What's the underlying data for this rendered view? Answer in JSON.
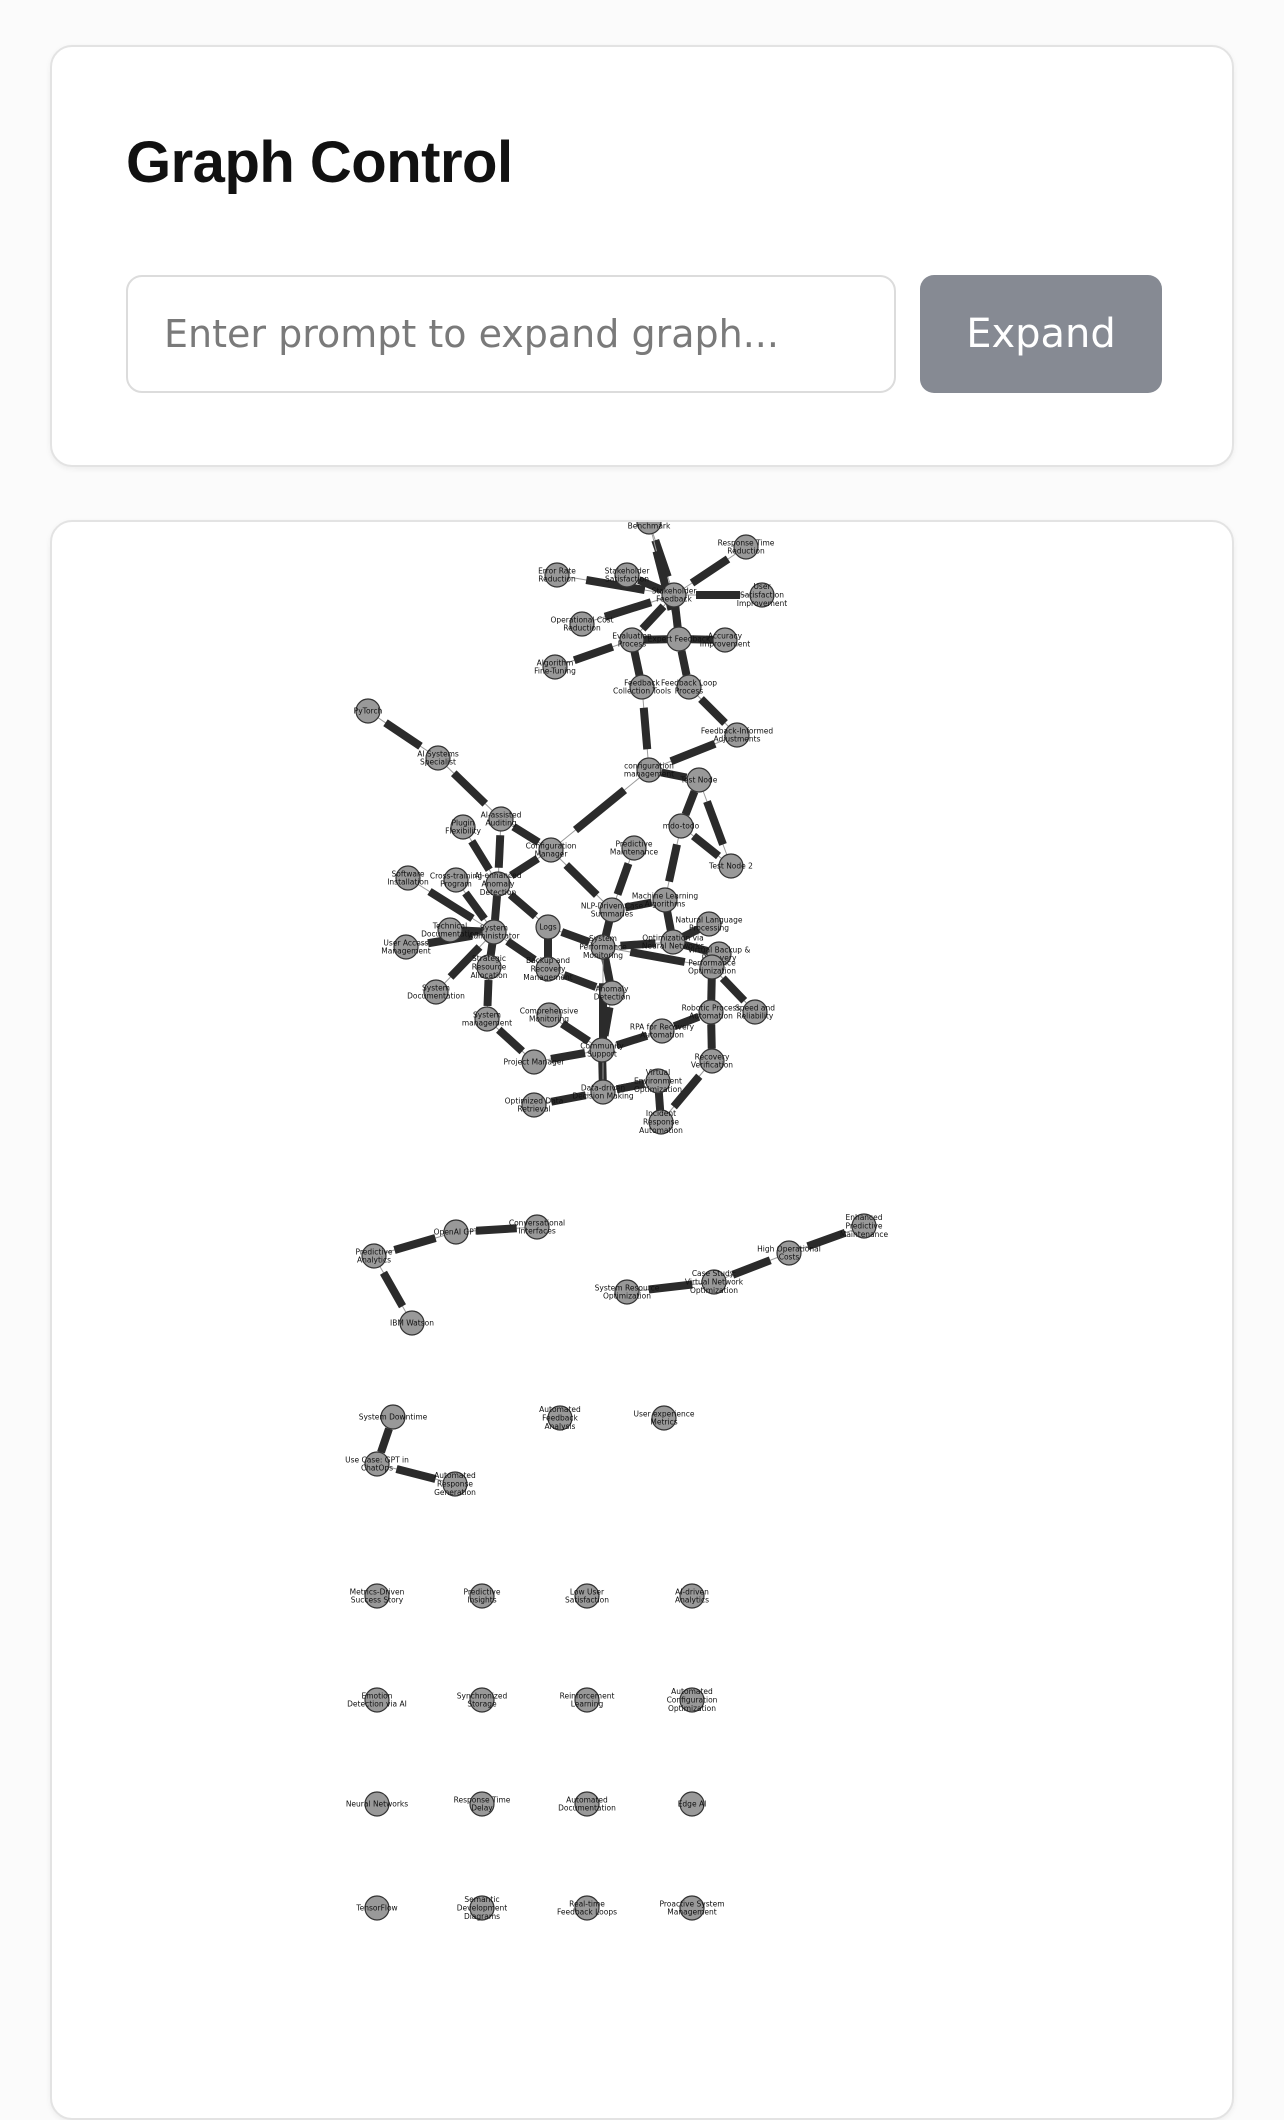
{
  "control": {
    "title": "Graph Control",
    "input_placeholder": "Enter prompt to expand graph...",
    "input_value": "",
    "expand_label": "Expand"
  },
  "graph": {
    "colors": {
      "node_fill": "#999999",
      "node_stroke": "#333333",
      "edge": "#2b2b2b"
    },
    "nodes": [
      {
        "id": "n_top",
        "label": "Performance Case Benchmark"
      },
      {
        "id": "n_resp_red",
        "label": "Response Time Reduction"
      },
      {
        "id": "n_err_red",
        "label": "Error Rate Reduction"
      },
      {
        "id": "n_stake_sat",
        "label": "Stakeholder Satisfaction"
      },
      {
        "id": "n_stake_fb",
        "label": "Stakeholder Feedback"
      },
      {
        "id": "n_user_sat",
        "label": "User Satisfaction Improvement"
      },
      {
        "id": "n_opcost",
        "label": "Operational Cost Reduction"
      },
      {
        "id": "n_eval",
        "label": "Evaluation Process"
      },
      {
        "id": "n_expert",
        "label": "Expert Feedback"
      },
      {
        "id": "n_accuracy",
        "label": "Accuracy Improvement"
      },
      {
        "id": "n_algo",
        "label": "Algorithm Fine-Tuning"
      },
      {
        "id": "n_fbcoll",
        "label": "Feedback Collection Tools"
      },
      {
        "id": "n_fbloop",
        "label": "Feedback Loop Process"
      },
      {
        "id": "n_pytorch",
        "label": "PyTorch"
      },
      {
        "id": "n_fbadj",
        "label": "Feedback-Informed Adjustments"
      },
      {
        "id": "n_aispec",
        "label": "AI Systems Specialist"
      },
      {
        "id": "n_config",
        "label": "configuration management"
      },
      {
        "id": "n_test",
        "label": "Test Node"
      },
      {
        "id": "n_aiassist",
        "label": "AI-assisted Auditing"
      },
      {
        "id": "n_plugin",
        "label": "Plugin Flexibility"
      },
      {
        "id": "n_mdo",
        "label": "mdo-todo"
      },
      {
        "id": "n_configmgr",
        "label": "Configuration Manager"
      },
      {
        "id": "n_predmaint",
        "label": "Predictive Maintenance"
      },
      {
        "id": "n_test2",
        "label": "Test Node 2"
      },
      {
        "id": "n_swinst",
        "label": "Software Installation"
      },
      {
        "id": "n_cross",
        "label": "Cross-training Program"
      },
      {
        "id": "n_aianom",
        "label": "AI-enhanced Anomaly Detection"
      },
      {
        "id": "n_ml",
        "label": "Machine Learning Algorithms"
      },
      {
        "id": "n_nlp",
        "label": "NLP-Driven Case Summaries"
      },
      {
        "id": "n_natlang",
        "label": "Natural Language Processing"
      },
      {
        "id": "n_techdoc",
        "label": "Technical Documentation"
      },
      {
        "id": "n_sysadmin",
        "label": "System Administrator"
      },
      {
        "id": "n_logs",
        "label": "Logs"
      },
      {
        "id": "n_useracc",
        "label": "User Access Management"
      },
      {
        "id": "n_sysperf",
        "label": "System Performance Monitoring"
      },
      {
        "id": "n_optnn",
        "label": "Optimization via Neural Networks"
      },
      {
        "id": "n_backup",
        "label": "Virtual Backup & Recovery"
      },
      {
        "id": "n_strat",
        "label": "Strategic Resource Allocation"
      },
      {
        "id": "n_bkrec",
        "label": "Backup and Recovery Management"
      },
      {
        "id": "n_perfopt",
        "label": "Performance Optimization"
      },
      {
        "id": "n_sysdoc",
        "label": "System Documentation"
      },
      {
        "id": "n_anomaly",
        "label": "Anomaly Detection"
      },
      {
        "id": "n_robproc",
        "label": "Robotic Process Automation"
      },
      {
        "id": "n_speed",
        "label": "Speed and Reliability"
      },
      {
        "id": "n_sysmgmt",
        "label": "System management"
      },
      {
        "id": "n_compmon",
        "label": "Comprehensive Monitoring"
      },
      {
        "id": "n_rpa",
        "label": "RPA for Recovery Automation"
      },
      {
        "id": "n_recver",
        "label": "Recovery Verification"
      },
      {
        "id": "n_projmgr",
        "label": "Project Manager"
      },
      {
        "id": "n_commsupport",
        "label": "Community Support"
      },
      {
        "id": "n_virtenv",
        "label": "Virtual Environment Optimization"
      },
      {
        "id": "n_datadriven",
        "label": "Data-driven Decision Making"
      },
      {
        "id": "n_optdata",
        "label": "Optimized Data Retrieval"
      },
      {
        "id": "n_incident",
        "label": "Incident Response Automation"
      },
      {
        "id": "n_convo",
        "label": "Conversational Interfaces"
      },
      {
        "id": "n_openai",
        "label": "OpenAI GPT"
      },
      {
        "id": "n_predanal",
        "label": "Predictive Analytics"
      },
      {
        "id": "n_ibm",
        "label": "IBM Watson"
      },
      {
        "id": "n_enhpred",
        "label": "Enhanced Predictive Maintenance"
      },
      {
        "id": "n_highcost",
        "label": "High Operational Costs"
      },
      {
        "id": "n_casestudy",
        "label": "Case Study: Virtual Network Optimization"
      },
      {
        "id": "n_sysres",
        "label": "System Resource Optimization"
      },
      {
        "id": "n_downtime",
        "label": "System Downtime"
      },
      {
        "id": "n_autofb",
        "label": "Automated Feedback Analysis"
      },
      {
        "id": "n_uxmetrics",
        "label": "User experience Metrics"
      },
      {
        "id": "n_chatgpt",
        "label": "Use Case: GPT in ChatOps"
      },
      {
        "id": "n_autoresp",
        "label": "Automated Response Generation"
      },
      {
        "id": "n_metrics",
        "label": "Metrics-Driven Success Story"
      },
      {
        "id": "n_predins",
        "label": "Predictive Insights"
      },
      {
        "id": "n_lowuser",
        "label": "Low User Satisfaction"
      },
      {
        "id": "n_aidriven",
        "label": "AI-driven Analytics"
      },
      {
        "id": "n_emotion",
        "label": "Emotion Detection via AI"
      },
      {
        "id": "n_synchro",
        "label": "Synchronized Storage"
      },
      {
        "id": "n_reinf",
        "label": "Reinforcement Learning"
      },
      {
        "id": "n_autoconf",
        "label": "Automated Configuration Optimization"
      },
      {
        "id": "n_neural",
        "label": "Neural Networks"
      },
      {
        "id": "n_resptime",
        "label": "Response Time Delay"
      },
      {
        "id": "n_autodoc",
        "label": "Automated Documentation"
      },
      {
        "id": "n_edge",
        "label": "Edge AI"
      },
      {
        "id": "n_tf",
        "label": "TensorFlow"
      },
      {
        "id": "n_sdd",
        "label": "Semantic Development Diagrams"
      },
      {
        "id": "n_realtime",
        "label": "Real-time Feedback Loops"
      },
      {
        "id": "n_proactive",
        "label": "Proactive System Management"
      }
    ],
    "edges": [
      [
        "n_top",
        "n_stake_fb"
      ],
      [
        "n_top",
        "n_expert"
      ],
      [
        "n_resp_red",
        "n_stake_fb"
      ],
      [
        "n_err_red",
        "n_stake_fb"
      ],
      [
        "n_stake_sat",
        "n_stake_fb"
      ],
      [
        "n_user_sat",
        "n_stake_fb"
      ],
      [
        "n_opcost",
        "n_stake_fb"
      ],
      [
        "n_eval",
        "n_stake_fb"
      ],
      [
        "n_expert",
        "n_stake_fb"
      ],
      [
        "n_accuracy",
        "n_expert"
      ],
      [
        "n_algo",
        "n_eval"
      ],
      [
        "n_eval",
        "n_expert"
      ],
      [
        "n_fbcoll",
        "n_eval"
      ],
      [
        "n_fbloop",
        "n_expert"
      ],
      [
        "n_fbloop",
        "n_fbadj"
      ],
      [
        "n_fbcoll",
        "n_config"
      ],
      [
        "n_fbadj",
        "n_config"
      ],
      [
        "n_pytorch",
        "n_aispec"
      ],
      [
        "n_aispec",
        "n_aiassist"
      ],
      [
        "n_config",
        "n_test"
      ],
      [
        "n_config",
        "n_configmgr"
      ],
      [
        "n_test",
        "n_mdo"
      ],
      [
        "n_test",
        "n_test2"
      ],
      [
        "n_mdo",
        "n_test2"
      ],
      [
        "n_mdo",
        "n_ml"
      ],
      [
        "n_aiassist",
        "n_configmgr"
      ],
      [
        "n_aiassist",
        "n_aianom"
      ],
      [
        "n_plugin",
        "n_aianom"
      ],
      [
        "n_configmgr",
        "n_aianom"
      ],
      [
        "n_configmgr",
        "n_nlp"
      ],
      [
        "n_predmaint",
        "n_nlp"
      ],
      [
        "n_swinst",
        "n_sysadmin"
      ],
      [
        "n_cross",
        "n_sysadmin"
      ],
      [
        "n_aianom",
        "n_sysadmin"
      ],
      [
        "n_aianom",
        "n_logs"
      ],
      [
        "n_techdoc",
        "n_sysadmin"
      ],
      [
        "n_useracc",
        "n_sysadmin"
      ],
      [
        "n_sysadmin",
        "n_strat"
      ],
      [
        "n_sysadmin",
        "n_bkrec"
      ],
      [
        "n_sysadmin",
        "n_sysdoc"
      ],
      [
        "n_logs",
        "n_sysperf"
      ],
      [
        "n_logs",
        "n_bkrec"
      ],
      [
        "n_ml",
        "n_optnn"
      ],
      [
        "n_ml",
        "n_nlp"
      ],
      [
        "n_natlang",
        "n_optnn"
      ],
      [
        "n_nlp",
        "n_sysperf"
      ],
      [
        "n_sysperf",
        "n_optnn"
      ],
      [
        "n_optnn",
        "n_backup"
      ],
      [
        "n_backup",
        "n_perfopt"
      ],
      [
        "n_sysperf",
        "n_perfopt"
      ],
      [
        "n_perfopt",
        "n_robproc"
      ],
      [
        "n_perfopt",
        "n_speed"
      ],
      [
        "n_bkrec",
        "n_anomaly"
      ],
      [
        "n_anomaly",
        "n_sysperf"
      ],
      [
        "n_strat",
        "n_sysmgmt"
      ],
      [
        "n_sysmgmt",
        "n_projmgr"
      ],
      [
        "n_compmon",
        "n_commsupport"
      ],
      [
        "n_robproc",
        "n_rpa"
      ],
      [
        "n_rpa",
        "n_commsupport"
      ],
      [
        "n_robproc",
        "n_recver"
      ],
      [
        "n_projmgr",
        "n_commsupport"
      ],
      [
        "n_commsupport",
        "n_datadriven"
      ],
      [
        "n_virtenv",
        "n_datadriven"
      ],
      [
        "n_recver",
        "n_incident"
      ],
      [
        "n_optdata",
        "n_datadriven"
      ],
      [
        "n_datadriven",
        "n_virtenv"
      ],
      [
        "n_virtenv",
        "n_incident"
      ],
      [
        "n_anomaly",
        "n_commsupport"
      ],
      [
        "n_sysperf",
        "n_datadriven"
      ],
      [
        "n_convo",
        "n_openai"
      ],
      [
        "n_openai",
        "n_predanal"
      ],
      [
        "n_predanal",
        "n_ibm"
      ],
      [
        "n_enhpred",
        "n_highcost"
      ],
      [
        "n_highcost",
        "n_casestudy"
      ],
      [
        "n_casestudy",
        "n_sysres"
      ],
      [
        "n_downtime",
        "n_chatgpt"
      ],
      [
        "n_chatgpt",
        "n_autoresp"
      ]
    ]
  }
}
